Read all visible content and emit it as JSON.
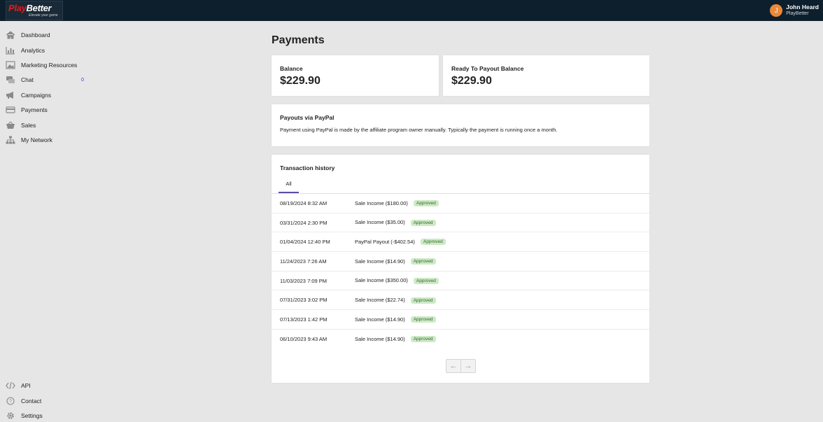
{
  "brand": {
    "logo_part1": "Play",
    "logo_part2": "Better",
    "tagline": "Elevate your game"
  },
  "user": {
    "initial": "J",
    "name": "John Heard",
    "org": "PlayBetter"
  },
  "sidebar": {
    "items": [
      {
        "label": "Dashboard",
        "icon": "home-icon"
      },
      {
        "label": "Analytics",
        "icon": "bar-chart-icon"
      },
      {
        "label": "Marketing Resources",
        "icon": "image-icon"
      },
      {
        "label": "Chat",
        "icon": "chat-icon",
        "badge": "0"
      },
      {
        "label": "Campaigns",
        "icon": "megaphone-icon"
      },
      {
        "label": "Payments",
        "icon": "credit-card-icon"
      },
      {
        "label": "Sales",
        "icon": "basket-icon"
      },
      {
        "label": "My Network",
        "icon": "network-icon"
      }
    ],
    "bottom": [
      {
        "label": "API",
        "icon": "code-icon"
      },
      {
        "label": "Contact",
        "icon": "help-icon"
      },
      {
        "label": "Settings",
        "icon": "gear-icon"
      }
    ]
  },
  "page": {
    "title": "Payments"
  },
  "balance": {
    "label": "Balance",
    "value": "$229.90"
  },
  "payout_balance": {
    "label": "Ready To Payout Balance",
    "value": "$229.90"
  },
  "paypal": {
    "title": "Payouts via PayPal",
    "text": "Payment using PayPal is made by the affiliate program owner manually. Typically the payment is running once a month."
  },
  "history": {
    "title": "Transaction history",
    "tab": "All",
    "rows": [
      {
        "date": "08/19/2024 8:32 AM",
        "desc": "Sale Income ($180.00)",
        "status": "Approved"
      },
      {
        "date": "03/31/2024 2:30 PM",
        "desc": "Sale Income ($35.00)",
        "status": "Approved"
      },
      {
        "date": "01/04/2024 12:40 PM",
        "desc": "PayPal Payout (-$402.54)",
        "status": "Approved"
      },
      {
        "date": "11/24/2023 7:26 AM",
        "desc": "Sale Income ($14.90)",
        "status": "Approved"
      },
      {
        "date": "11/03/2023 7:09 PM",
        "desc": "Sale Income ($350.00)",
        "status": "Approved"
      },
      {
        "date": "07/31/2023 3:02 PM",
        "desc": "Sale Income ($22.74)",
        "status": "Approved"
      },
      {
        "date": "07/13/2023 1:42 PM",
        "desc": "Sale Income ($14.90)",
        "status": "Approved"
      },
      {
        "date": "06/10/2023 9:43 AM",
        "desc": "Sale Income ($14.90)",
        "status": "Approved"
      }
    ],
    "prev": "←",
    "next": "→"
  }
}
